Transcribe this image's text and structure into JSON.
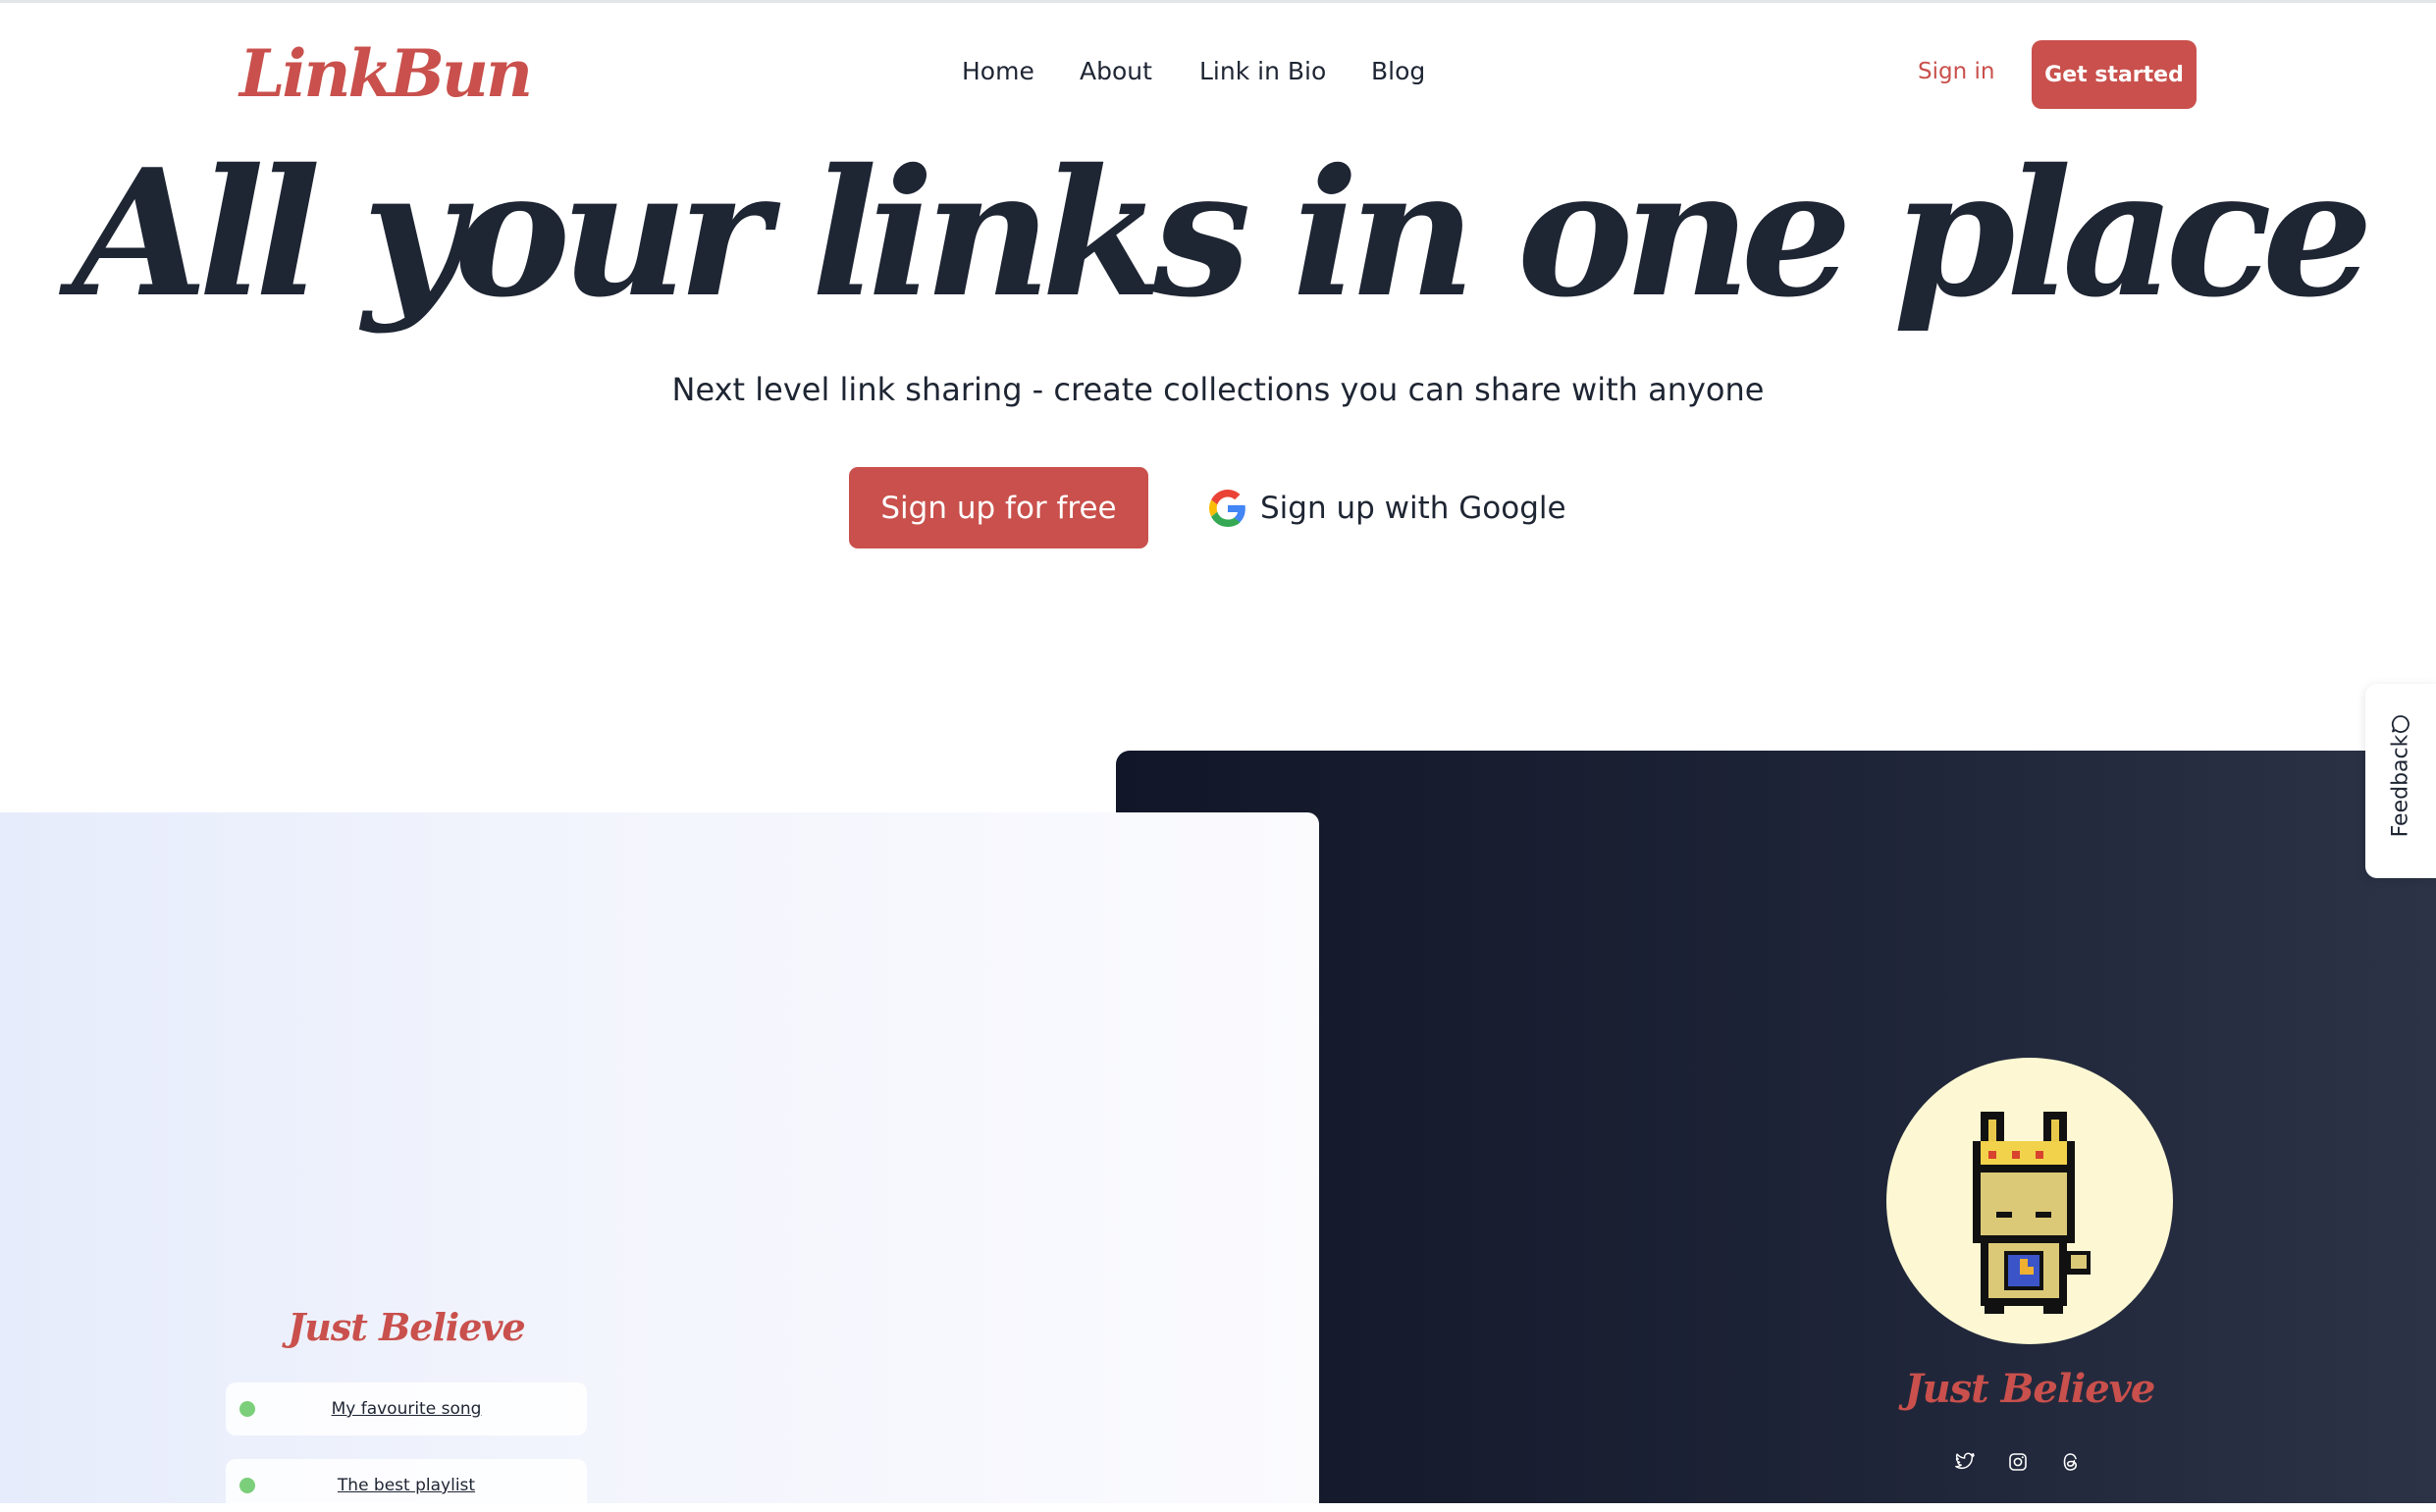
{
  "brand": {
    "logo_text": "LinkBun",
    "accent": "#c9504c"
  },
  "nav": {
    "items": [
      "Home",
      "About",
      "Link in Bio",
      "Blog"
    ]
  },
  "auth": {
    "sign_in": "Sign in",
    "get_started": "Get started"
  },
  "hero": {
    "title": "All your links in one place",
    "subtitle": "Next level link sharing - create collections you can share with anyone",
    "cta_primary": "Sign up for free",
    "cta_google": "Sign up with Google"
  },
  "preview_light": {
    "title": "Just Believe",
    "links": [
      "My favourite song",
      "The best playlist"
    ]
  },
  "preview_dark": {
    "title": "Just Believe",
    "avatar_icon": "pixel-rabbit-king-icon",
    "socials": [
      "twitter-icon",
      "instagram-icon",
      "threads-icon"
    ]
  },
  "feedback": {
    "label": "Feedback"
  }
}
